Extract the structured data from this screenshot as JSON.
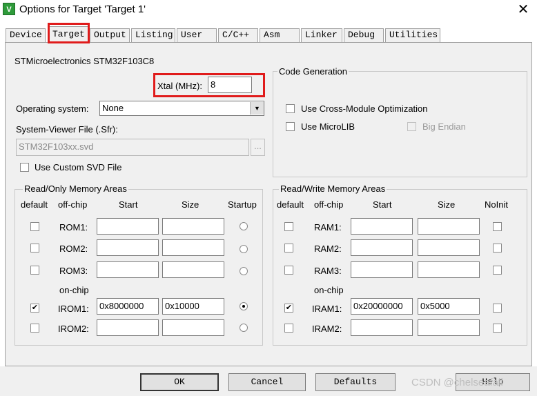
{
  "window": {
    "title": "Options for Target 'Target 1'",
    "icon": "keil-app-icon",
    "close": "✕"
  },
  "tabs": [
    {
      "label": "Device"
    },
    {
      "label": "Target",
      "active": true
    },
    {
      "label": "Output"
    },
    {
      "label": "Listing"
    },
    {
      "label": "User"
    },
    {
      "label": "C/C++"
    },
    {
      "label": "Asm"
    },
    {
      "label": "Linker"
    },
    {
      "label": "Debug"
    },
    {
      "label": "Utilities"
    }
  ],
  "target": {
    "device": "STMicroelectronics STM32F103C8",
    "xtal_label": "Xtal (MHz):",
    "xtal_value": "8",
    "os_label": "Operating system:",
    "os_value": "None",
    "sfr_label": "System-Viewer File (.Sfr):",
    "sfr_value": "STM32F103xx.svd",
    "browse": "...",
    "custom_svd": "Use Custom SVD File"
  },
  "code_gen": {
    "title": "Code Generation",
    "cross_module": "Use Cross-Module Optimization",
    "microlib": "Use MicroLIB",
    "big_endian": "Big Endian"
  },
  "ro_memory": {
    "title": "Read/Only Memory Areas",
    "headers": {
      "default": "default",
      "offchip": "off-chip",
      "start": "Start",
      "size": "Size",
      "last": "Startup"
    },
    "onchip_label": "on-chip",
    "rows": [
      {
        "name": "ROM1:",
        "start": "",
        "size": "",
        "default": false,
        "startup": false
      },
      {
        "name": "ROM2:",
        "start": "",
        "size": "",
        "default": false,
        "startup": false
      },
      {
        "name": "ROM3:",
        "start": "",
        "size": "",
        "default": false,
        "startup": false
      },
      {
        "name": "IROM1:",
        "start": "0x8000000",
        "size": "0x10000",
        "default": true,
        "startup": true
      },
      {
        "name": "IROM2:",
        "start": "",
        "size": "",
        "default": false,
        "startup": false
      }
    ]
  },
  "rw_memory": {
    "title": "Read/Write Memory Areas",
    "headers": {
      "default": "default",
      "offchip": "off-chip",
      "start": "Start",
      "size": "Size",
      "last": "NoInit"
    },
    "onchip_label": "on-chip",
    "rows": [
      {
        "name": "RAM1:",
        "start": "",
        "size": "",
        "default": false,
        "noinit": false
      },
      {
        "name": "RAM2:",
        "start": "",
        "size": "",
        "default": false,
        "noinit": false
      },
      {
        "name": "RAM3:",
        "start": "",
        "size": "",
        "default": false,
        "noinit": false
      },
      {
        "name": "IRAM1:",
        "start": "0x20000000",
        "size": "0x5000",
        "default": true,
        "noinit": false
      },
      {
        "name": "IRAM2:",
        "start": "",
        "size": "",
        "default": false,
        "noinit": false
      }
    ]
  },
  "buttons": {
    "ok": "OK",
    "cancel": "Cancel",
    "defaults": "Defaults",
    "help": "Help"
  },
  "watermark": "CSDN @chelseafall",
  "colors": {
    "highlight": "#e01b1b",
    "panel": "#f0f0f0"
  }
}
